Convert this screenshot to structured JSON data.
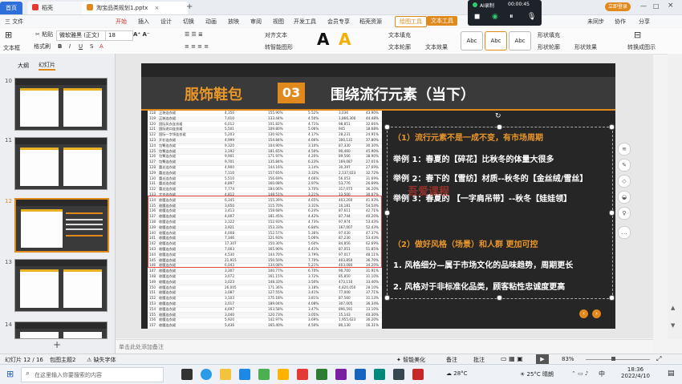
{
  "titlebar": {
    "tabs": [
      {
        "label": "首页"
      },
      {
        "label": "稻壳"
      },
      {
        "label": "淘宝品类规划1.pptx"
      }
    ],
    "login_button": "立即登录",
    "time": "18:36"
  },
  "menubar": {
    "file": "三 文件",
    "items": [
      "开始",
      "插入",
      "设计",
      "切换",
      "动画",
      "放映",
      "审阅",
      "视图",
      "开发工具",
      "会员专享",
      "稻壳资源"
    ],
    "drawing_tools": "绘图工具",
    "text_tools": "文本工具",
    "right_items": [
      "未同步",
      "协作",
      "分享"
    ]
  },
  "ribbon": {
    "textbox": "文本框",
    "paste": "粘贴",
    "format_painter": "格式刷",
    "font_name": "微软雅黑 (正文)",
    "font_size": "18",
    "align_label": "对齐文本",
    "convert_smartart": "转智能图形",
    "text_fill": "文本填充",
    "text_outline": "文本轮廓",
    "text_effect": "文本效果",
    "shape_fill": "形状填充",
    "shape_outline": "形状轮廓",
    "shape_effect": "形状效果",
    "transform": "转换成图示",
    "style_abc": "Abc"
  },
  "recorder": {
    "title": "AI录制",
    "timer": "00:00:45"
  },
  "left_pane": {
    "tab_outline": "大纲",
    "tab_slides": "幻灯片",
    "slide_numbers": [
      "10",
      "11",
      "12",
      "13",
      "14"
    ],
    "selected": "12"
  },
  "slide": {
    "category": "服饰鞋包",
    "number": "03",
    "heading": "围绕流行元素（当下）",
    "point1_title": "（1）流行元素不是一成不变，有市场周期",
    "point1_items": [
      "举例 1：春夏的【碎花】比秋冬的体量大很多",
      "举例 2：春下的【雪纺】材质--秋冬的【金丝绒/雪丝】",
      "举例 3：春夏的 【一字肩吊带】--秋冬【娃娃领】"
    ],
    "point2_title": "（2）做好风格（场景）和人群 更加可控",
    "point2_items": [
      "1. 风格细分—属于市场文化的品味趋势，周期更长",
      "2. 风格对于非标准化品类，顾客粘性忠诚度更高"
    ],
    "watermark": "吾爱课程"
  },
  "sheet_rows": [
    {
      "no": "118",
      "name": "正装连衣裙",
      "a": "4,356",
      "b": "155.90%",
      "c": "5.52%",
      "d": "3,036",
      "e": "43.90%"
    },
    {
      "no": "119",
      "name": "正装连衣裙",
      "a": "7,010",
      "b": "133.44%",
      "c": "4.50%",
      "d": "1,866,300",
      "e": "44.48%"
    },
    {
      "no": "120",
      "name": "国际风衣连衣裙",
      "a": "6,012",
      "b": "101.82%",
      "c": "4.71%",
      "d": "98,851",
      "e": "32.66%"
    },
    {
      "no": "121",
      "name": "国际进口连衣裙",
      "a": "5,501",
      "b": "109.80%",
      "c": "5.06%",
      "d": "945",
      "e": "18.68%"
    },
    {
      "no": "122",
      "name": "国际一字领连衣裙",
      "a": "5,203",
      "b": "130.92%",
      "c": "4.17%",
      "d": "28,231",
      "e": "24.91%"
    },
    {
      "no": "123",
      "name": "开衫连衣裙",
      "a": "4,999",
      "b": "154.84%",
      "c": "4.66%",
      "d": "300,131",
      "e": "37.80%"
    },
    {
      "no": "124",
      "name": "包臀连衣裙",
      "a": "9,320",
      "b": "104.90%",
      "c": "3.10%",
      "d": "87,330",
      "e": "30.30%"
    },
    {
      "no": "125",
      "name": "包臀连衣裙",
      "a": "3,192",
      "b": "181.65%",
      "c": "4.50%",
      "d": "90,460",
      "e": "45.90%"
    },
    {
      "no": "126",
      "name": "包臀连衣裙",
      "a": "9,901",
      "b": "171.97%",
      "c": "4.20%",
      "d": "89,566",
      "e": "38.90%"
    },
    {
      "no": "127",
      "name": "包臀连衣裙",
      "a": "9,701",
      "b": "135.84%",
      "c": "6.23%",
      "d": "169,087",
      "e": "27.01%"
    },
    {
      "no": "128",
      "name": "蕾丝连衣裙",
      "a": "4,900",
      "b": "144.16%",
      "c": "3.14%",
      "d": "30,397",
      "e": "27.69%"
    },
    {
      "no": "129",
      "name": "蕾丝连衣裙",
      "a": "7,110",
      "b": "157.65%",
      "c": "3.32%",
      "d": "2,137,023",
      "e": "32.72%"
    },
    {
      "no": "130",
      "name": "蕾丝连衣裙",
      "a": "5,510",
      "b": "156.69%",
      "c": "4.66%",
      "d": "56,053",
      "e": "31.69%"
    },
    {
      "no": "131",
      "name": "蕾丝连衣裙",
      "a": "4,897",
      "b": "160.08%",
      "c": "2.97%",
      "d": "53,776",
      "e": "26.69%"
    },
    {
      "no": "132",
      "name": "蕾丝连衣裙",
      "a": "7,774",
      "b": "184.06%",
      "c": "3.70%",
      "d": "317,075",
      "e": "36.20%"
    },
    {
      "no": "133",
      "name": "大衣连衣裙",
      "a": "4,812",
      "b": "148.51%",
      "c": "3.21%",
      "d": "13,500",
      "e": "30.07%"
    },
    {
      "no": "134",
      "name": "收腰连衣裙",
      "a": "6,345",
      "b": "155.39%",
      "c": "4.65%",
      "d": "403,260",
      "e": "41.93%"
    },
    {
      "no": "135",
      "name": "收腰连衣裙",
      "a": "3,650",
      "b": "115.70%",
      "c": "3.31%",
      "d": "10,181",
      "e": "54.54%"
    },
    {
      "no": "136",
      "name": "收腰连衣裙",
      "a": "3,413",
      "b": "158.68%",
      "c": "6.24%",
      "d": "87,611",
      "e": "42.71%"
    },
    {
      "no": "137",
      "name": "收腰连衣裙",
      "a": "4,007",
      "b": "181.45%",
      "c": "4.42%",
      "d": "87,744",
      "e": "40.20%"
    },
    {
      "no": "138",
      "name": "收腰连衣裙",
      "a": "3,322",
      "b": "152.93%",
      "c": "4.73%",
      "d": "97,974",
      "e": "53.43%"
    },
    {
      "no": "139",
      "name": "收腰连衣裙",
      "a": "3,921",
      "b": "153.33%",
      "c": "6.84%",
      "d": "167,007",
      "e": "52.43%"
    },
    {
      "no": "140",
      "name": "收腰连衣裙",
      "a": "4,008",
      "b": "152.57%",
      "c": "5.36%",
      "d": "97,030",
      "e": "47.37%"
    },
    {
      "no": "141",
      "name": "收腰连衣裙",
      "a": "7,346",
      "b": "121.93%",
      "c": "5.06%",
      "d": "87,230",
      "e": "53.43%"
    },
    {
      "no": "142",
      "name": "收腰连衣裙",
      "a": "17,307",
      "b": "150.30%",
      "c": "5.60%",
      "d": "84,856",
      "e": "62.69%"
    },
    {
      "no": "143",
      "name": "收腰连衣裙",
      "a": "7,003",
      "b": "165.90%",
      "c": "4.41%",
      "d": "87,051",
      "e": "51.85%"
    },
    {
      "no": "144",
      "name": "收腰连衣裙",
      "a": "4,530",
      "b": "144.70%",
      "c": "3.79%",
      "d": "97,017",
      "e": "48.11%"
    },
    {
      "no": "145",
      "name": "收腰连衣裙",
      "a": "21,915",
      "b": "150.50%",
      "c": "7.70%",
      "d": "403,850",
      "e": "36.70%"
    },
    {
      "no": "146",
      "name": "收腰连衣裙",
      "a": "6,043",
      "b": "134.08%",
      "c": "5.21%",
      "d": "403,080",
      "e": "34.20%"
    },
    {
      "no": "147",
      "name": "收腰连衣裙",
      "a": "3,307",
      "b": "100.77%",
      "c": "6.70%",
      "d": "90,700",
      "e": "31.91%"
    },
    {
      "no": "148",
      "name": "收腰连衣裙",
      "a": "3,072",
      "b": "161.15%",
      "c": "3.72%",
      "d": "85,850",
      "e": "31.10%"
    },
    {
      "no": "149",
      "name": "收腰连衣裙",
      "a": "3,023",
      "b": "148.33%",
      "c": "3.50%",
      "d": "473,110",
      "e": "33.40%"
    },
    {
      "no": "150",
      "name": "收腰连衣裙",
      "a": "26,005",
      "b": "171.36%",
      "c": "3.18%",
      "d": "4,820,050",
      "e": "28.10%"
    },
    {
      "no": "151",
      "name": "收腰连衣裙",
      "a": "3,087",
      "b": "127.55%",
      "c": "3.41%",
      "d": "77,000",
      "e": "37.71%"
    },
    {
      "no": "152",
      "name": "收腰连衣裙",
      "a": "3,103",
      "b": "175.18%",
      "c": "3.81%",
      "d": "87,560",
      "e": "31.13%"
    },
    {
      "no": "153",
      "name": "收腰连衣裙",
      "a": "3,017",
      "b": "189.04%",
      "c": "4.08%",
      "d": "307,005",
      "e": "36.34%"
    },
    {
      "no": "154",
      "name": "收腰连衣裙",
      "a": "4,697",
      "b": "163.58%",
      "c": "3.47%",
      "d": "896,591",
      "e": "33.10%"
    },
    {
      "no": "155",
      "name": "收腰连衣裙",
      "a": "3,040",
      "b": "120.73%",
      "c": "3.05%",
      "d": "15,143",
      "e": "40.30%"
    },
    {
      "no": "156",
      "name": "收腰连衣裙",
      "a": "5,920",
      "b": "142.97%",
      "c": "3.69%",
      "d": "1,955,623",
      "e": "36.20%"
    },
    {
      "no": "157",
      "name": "收腰连衣裙",
      "a": "5,436",
      "b": "165.40%",
      "c": "4.50%",
      "d": "80,130",
      "e": "16.31%"
    }
  ],
  "notes": {
    "placeholder": "单击此处添加备注"
  },
  "status": {
    "slide_count": "幻灯片 12 / 16",
    "theme": "包图主题2",
    "missing_font": "缺失字体",
    "smart_beautify": "智能美化",
    "notes": "备注",
    "comments": "批注",
    "zoom": "83%"
  },
  "taskbar": {
    "search_placeholder": "在这里输入你要搜索的内容",
    "weather1": "28°C",
    "weather2": "25°C 晴朗",
    "time": "18:36",
    "date": "2022/4/10",
    "ime": "中"
  },
  "colors": {
    "accent_orange": "#e0891c",
    "slide_bg": "#262626",
    "wps_red": "#c0392b",
    "home_blue": "#2f6fd9"
  }
}
